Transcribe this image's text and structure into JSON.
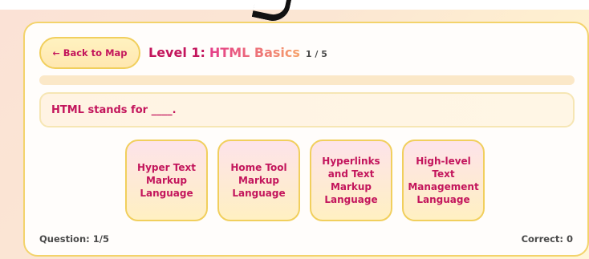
{
  "header": {
    "back_label": "Back to Map",
    "back_icon": "left-arrow-icon",
    "level_prefix": "Level 1:",
    "level_name": "HTML Basics",
    "question_count": "1 / 5"
  },
  "progress": {
    "fraction": 0.0
  },
  "question": {
    "text": "HTML stands for ____."
  },
  "options": [
    {
      "label": "Hyper Text Markup Language"
    },
    {
      "label": "Home Tool Markup Language"
    },
    {
      "label": "Hyperlinks and Text Markup Language"
    },
    {
      "label": "High-level Text Management Language"
    }
  ],
  "footer": {
    "question_status": "Question: 1/5",
    "correct_status": "Correct: 0"
  },
  "colors": {
    "accent": "#c3155c",
    "border": "#f1cf5d",
    "text_dark": "#4a4a4a"
  }
}
